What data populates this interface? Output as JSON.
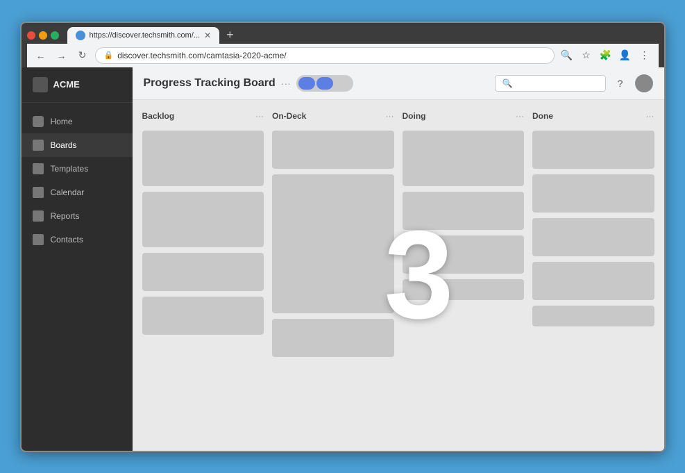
{
  "browser": {
    "url": "discover.techsmith.com/camtasia-2020-acme/",
    "tab_label": "https://discover.techsmith.com/...",
    "window_controls": [
      "close",
      "minimize",
      "maximize"
    ]
  },
  "sidebar": {
    "title": "ACME",
    "items": [
      {
        "label": "Home",
        "icon": "home-icon",
        "active": false
      },
      {
        "label": "Boards",
        "icon": "boards-icon",
        "active": true
      },
      {
        "label": "Templates",
        "icon": "templates-icon",
        "active": false
      },
      {
        "label": "Calendar",
        "icon": "calendar-icon",
        "active": false
      },
      {
        "label": "Reports",
        "icon": "reports-icon",
        "active": false
      },
      {
        "label": "Contacts",
        "icon": "contacts-icon",
        "active": false
      }
    ]
  },
  "board": {
    "title": "Progress Tracking Board",
    "more_icon": "...",
    "columns": [
      {
        "id": "backlog",
        "label": "Backlog",
        "cards": [
          {
            "size": "tall"
          },
          {
            "size": "tall"
          },
          {
            "size": "medium"
          },
          {
            "size": "medium"
          }
        ]
      },
      {
        "id": "on-deck",
        "label": "On-Deck",
        "cards": [
          {
            "size": "medium"
          },
          {
            "size": "tall"
          },
          {
            "size": "medium"
          }
        ]
      },
      {
        "id": "doing",
        "label": "Doing",
        "cards": [
          {
            "size": "tall"
          },
          {
            "size": "medium"
          },
          {
            "size": "medium"
          },
          {
            "size": "short"
          }
        ]
      },
      {
        "id": "done",
        "label": "Done",
        "cards": [
          {
            "size": "medium"
          },
          {
            "size": "medium"
          },
          {
            "size": "medium"
          },
          {
            "size": "medium"
          },
          {
            "size": "short"
          }
        ]
      }
    ]
  },
  "overlay": {
    "number": "3"
  },
  "toggle": {
    "state": "on"
  },
  "topbar": {
    "search_placeholder": "Search..."
  }
}
